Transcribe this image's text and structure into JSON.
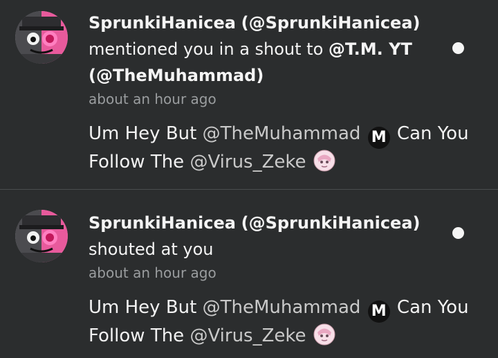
{
  "notifications": [
    {
      "sender_display": "SprunkiHanicea",
      "sender_handle": "(@SprunkiHanicea)",
      "action_text": "mentioned you in a shout to",
      "target_display": "@T.M. YT",
      "target_handle": "(@TheMuhammad)",
      "timestamp": "about an hour ago",
      "message": {
        "part1": "Um Hey But ",
        "mention1": "@TheMuhammad",
        "emoji1": "M",
        "part2": " Can You Follow The ",
        "mention2": "@Virus_Zeke"
      },
      "unread": true
    },
    {
      "sender_display": "SprunkiHanicea",
      "sender_handle": "(@SprunkiHanicea)",
      "action_text": "shouted at you",
      "timestamp": "about an hour ago",
      "message": {
        "part1": "Um Hey But ",
        "mention1": "@TheMuhammad",
        "emoji1": "M",
        "part2": " Can You Follow The ",
        "mention2": "@Virus_Zeke"
      },
      "unread": true
    }
  ],
  "icons": {
    "avatar": "sprunki-avatar-icon",
    "m_badge": "m-emoji-icon",
    "zeke": "zeke-emoji-icon",
    "unread": "unread-dot-icon"
  },
  "colors": {
    "background": "#2b2d2e",
    "text": "#f4f4f4",
    "muted": "#9a9d9f",
    "mention": "#c9c9c9",
    "avatar_pink": "#e85a9c",
    "avatar_gray": "#4b4b4f"
  }
}
